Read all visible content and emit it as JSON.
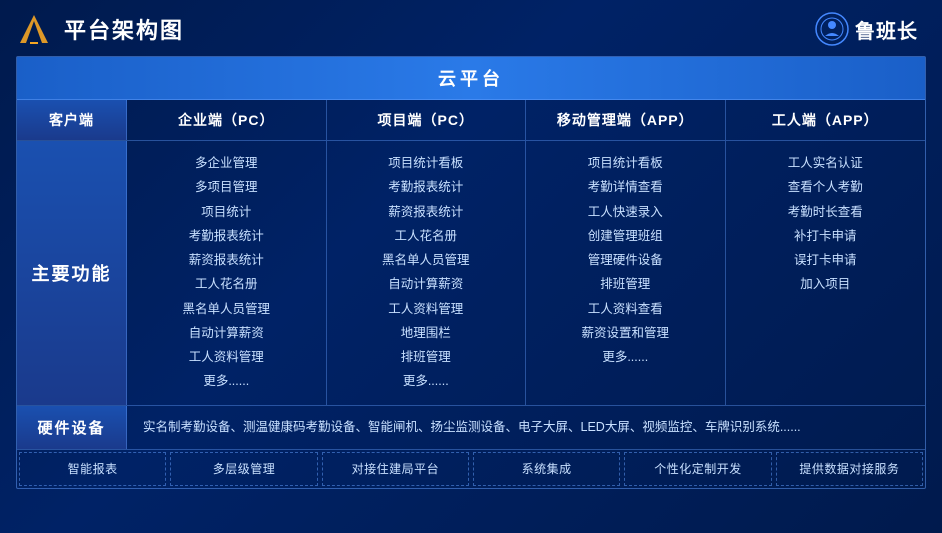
{
  "header": {
    "title": "平台架构图",
    "brand_name": "鲁班长"
  },
  "cloud_platform": {
    "label": "云平台"
  },
  "columns": {
    "client": "客户端",
    "enterprise": "企业端（PC）",
    "project": "项目端（PC）",
    "mobile": "移动管理端（APP）",
    "worker": "工人端（APP）"
  },
  "main_function_label": "主要功能",
  "enterprise_items": [
    "多企业管理",
    "多项目管理",
    "项目统计",
    "考勤报表统计",
    "薪资报表统计",
    "工人花名册",
    "黑名单人员管理",
    "自动计算薪资",
    "工人资料管理",
    "更多......"
  ],
  "project_items": [
    "项目统计看板",
    "考勤报表统计",
    "薪资报表统计",
    "工人花名册",
    "黑名单人员管理",
    "自动计算薪资",
    "工人资料管理",
    "地理围栏",
    "排班管理",
    "更多......"
  ],
  "mobile_items": [
    "项目统计看板",
    "考勤详情查看",
    "工人快速录入",
    "创建管理班组",
    "管理硬件设备",
    "排班管理",
    "工人资料查看",
    "薪资设置和管理",
    "更多......"
  ],
  "worker_items": [
    "工人实名认证",
    "查看个人考勤",
    "考勤时长查看",
    "补打卡申请",
    "误打卡申请",
    "加入项目"
  ],
  "hardware": {
    "label": "硬件设备",
    "content": "实名制考勤设备、测温健康码考勤设备、智能闸机、扬尘监测设备、电子大屏、LED大屏、视频监控、车牌识别系统......"
  },
  "features": [
    "智能报表",
    "多层级管理",
    "对接住建局平台",
    "系统集成",
    "个性化定制开发",
    "提供数据对接服务"
  ]
}
